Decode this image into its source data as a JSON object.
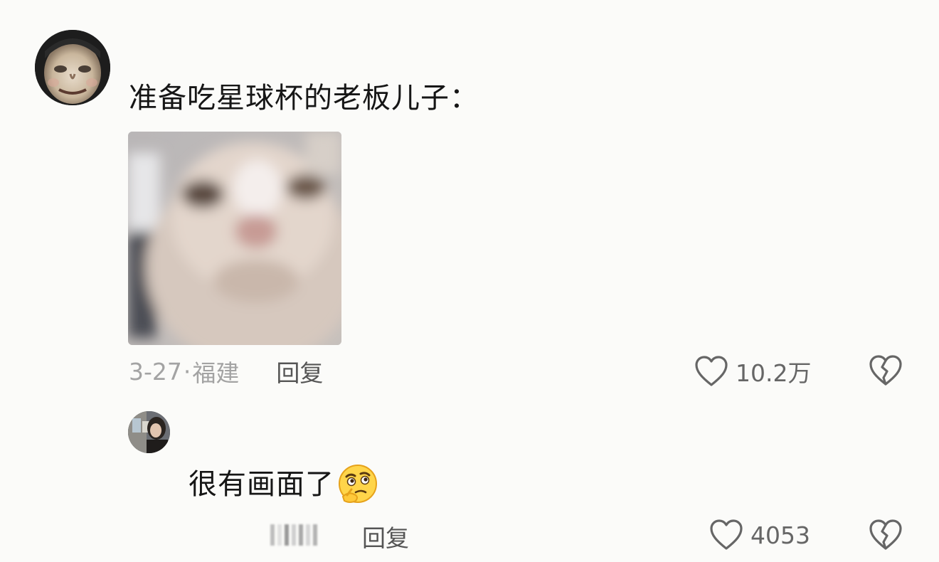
{
  "main_comment": {
    "avatar": "user-avatar-face-photo",
    "text": "准备吃星球杯的老板儿子：",
    "image": "blurred-cat-closeup-photo",
    "date": "3-27",
    "separator": "·",
    "location": "福建",
    "reply_label": "回复",
    "like_count": "10.2万",
    "like_icon": "heart-outline-icon",
    "dislike_icon": "broken-heart-icon"
  },
  "reply_comment": {
    "avatar": "user-avatar-girl-photo",
    "text": "很有画面了",
    "emoji": "thinking-face-emoji",
    "reply_label": "回复",
    "like_count": "4053",
    "like_icon": "heart-outline-icon",
    "dislike_icon": "broken-heart-icon"
  },
  "colors": {
    "background": "#fbfbf9",
    "text_primary": "#161616",
    "text_meta": "#a3a3a3",
    "text_action": "#555555",
    "icon_stroke": "#666666"
  }
}
